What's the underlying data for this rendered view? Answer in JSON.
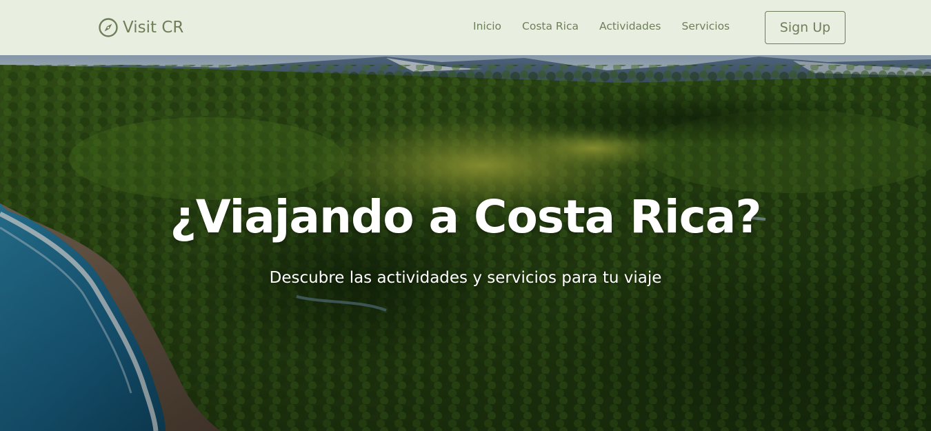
{
  "navbar": {
    "brand": {
      "icon": "compass-icon",
      "text": "Visit CR"
    },
    "links": [
      {
        "label": "Inicio"
      },
      {
        "label": "Costa Rica"
      },
      {
        "label": "Actividades"
      },
      {
        "label": "Servicios"
      }
    ],
    "signup_label": "Sign Up"
  },
  "hero": {
    "background": "aerial-rainforest-coast-photo",
    "title": "¿Viajando a Costa Rica?",
    "subtitle": "Descubre las actividades y servicios para tu viaje"
  },
  "colors": {
    "navbar_bg": "#e8efe0",
    "brand_accent": "#6f7e5a",
    "hero_text": "#ffffff"
  }
}
